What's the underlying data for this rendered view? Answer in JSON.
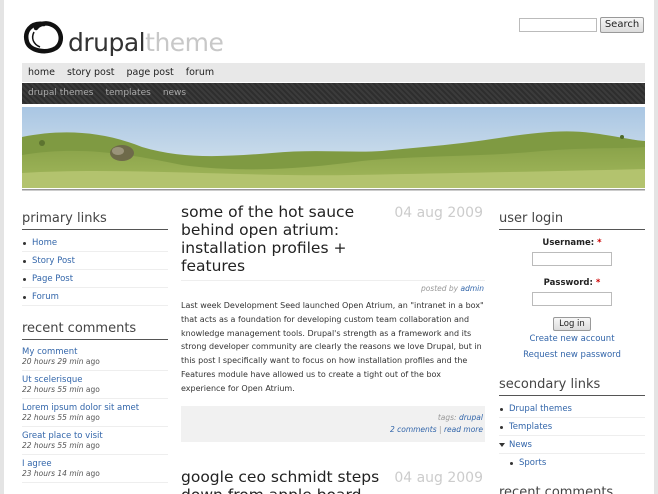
{
  "site": {
    "name_part1": "drupal",
    "name_part2": "theme"
  },
  "search": {
    "button_label": "Search",
    "value": ""
  },
  "primary_nav": [
    "home",
    "story post",
    "page post",
    "forum"
  ],
  "secondary_nav": [
    "drupal themes",
    "templates",
    "news"
  ],
  "primary_links": {
    "title": "primary links",
    "items": [
      "Home",
      "Story Post",
      "Page Post",
      "Forum"
    ]
  },
  "recent_comments": {
    "title": "recent comments",
    "items": [
      {
        "title": "My comment",
        "time": "20 hours 29 min",
        "ago": "ago"
      },
      {
        "title": "Ut scelerisque",
        "time": "22 hours 55 min",
        "ago": "ago"
      },
      {
        "title": "Lorem ipsum dolor sit amet",
        "time": "22 hours 55 min",
        "ago": "ago"
      },
      {
        "title": "Great place to visit",
        "time": "22 hours 55 min",
        "ago": "ago"
      },
      {
        "title": "I agree",
        "time": "23 hours 14 min",
        "ago": "ago"
      }
    ]
  },
  "nodes": [
    {
      "title": "some of the hot sauce behind open atrium: installation profiles + features",
      "date": "04 aug 2009",
      "posted_by": "posted by",
      "author": "admin",
      "body": "Last week Development Seed launched Open Atrium, an \"intranet in a box\" that acts as a foundation for developing custom team collaboration and knowledge management tools. Drupal's strength as a framework and its strong developer community are clearly the reasons we love Drupal, but in this post I specifically want to focus on how installation profiles and the Features module have allowed us to create a tight out of the box experience for Open Atrium.",
      "tags_label": "tags:",
      "tag": "drupal",
      "comments_link": "2 comments",
      "separator": "|",
      "read_more": "read more"
    },
    {
      "title": "google ceo schmidt steps down from apple board",
      "date": "04 aug 2009"
    }
  ],
  "user_login": {
    "title": "user login",
    "username_label": "Username:",
    "password_label": "Password:",
    "required_mark": "*",
    "button_label": "Log in",
    "create_account": "Create new account",
    "request_password": "Request new password"
  },
  "secondary_links": {
    "title": "secondary links",
    "items": [
      "Drupal themes",
      "Templates",
      "News"
    ],
    "child": "Sports"
  },
  "recent_comments_right": {
    "title": "recent comments"
  }
}
